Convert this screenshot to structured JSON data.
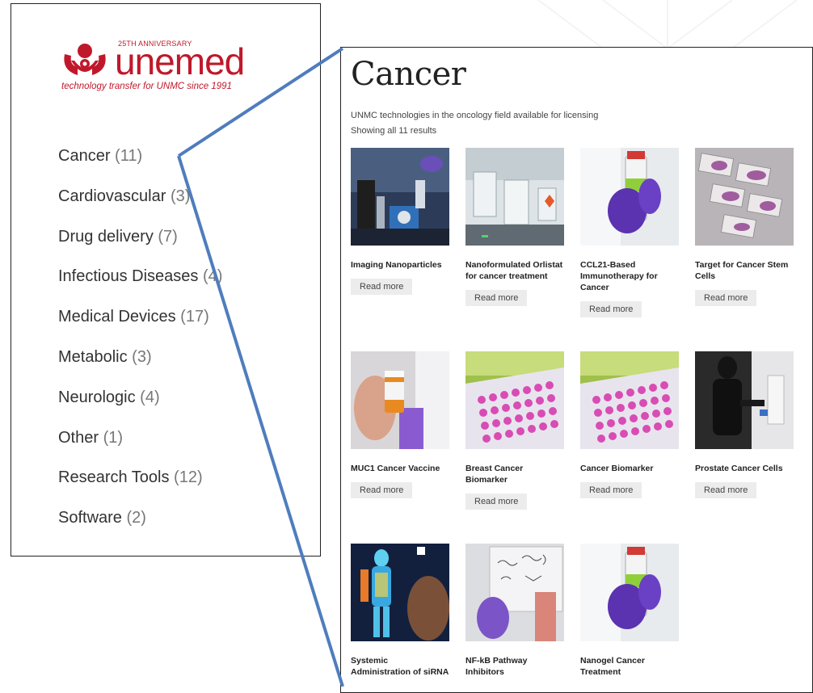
{
  "logo": {
    "anniversary": "25TH ANNIVERSARY",
    "wordmark": "unemed",
    "tagline": "technology transfer for UNMC since 1991",
    "brand_color": "#c0182b"
  },
  "categories": [
    {
      "label": "Cancer",
      "count": "(11)"
    },
    {
      "label": "Cardiovascular",
      "count": "(3)"
    },
    {
      "label": "Drug delivery",
      "count": "(7)"
    },
    {
      "label": "Infectious Diseases",
      "count": "(4)"
    },
    {
      "label": "Medical Devices",
      "count": "(17)"
    },
    {
      "label": "Metabolic",
      "count": "(3)"
    },
    {
      "label": "Neurologic",
      "count": "(4)"
    },
    {
      "label": "Other",
      "count": "(1)"
    },
    {
      "label": "Research Tools",
      "count": "(12)"
    },
    {
      "label": "Software",
      "count": "(2)"
    }
  ],
  "page": {
    "title": "Cancer",
    "description": "UNMC technologies in the oncology field available for licensing",
    "results": "Showing all 11 results",
    "read_more": "Read more"
  },
  "products": [
    {
      "name": "Imaging Nanoparticles"
    },
    {
      "name": "Nanoformulated Orlistat for cancer treatment"
    },
    {
      "name": "CCL21-Based Immunotherapy for Cancer"
    },
    {
      "name": "Target for Cancer Stem Cells"
    },
    {
      "name": "MUC1 Cancer Vaccine"
    },
    {
      "name": "Breast Cancer Biomarker"
    },
    {
      "name": "Cancer Biomarker"
    },
    {
      "name": "Prostate Cancer Cells"
    },
    {
      "name": "Systemic Administration of siRNA"
    },
    {
      "name": "NF-kB Pathway Inhibitors"
    },
    {
      "name": "Nanogel Cancer Treatment"
    }
  ],
  "colors": {
    "connector": "#4f7dbd",
    "button_bg": "#ececec"
  }
}
